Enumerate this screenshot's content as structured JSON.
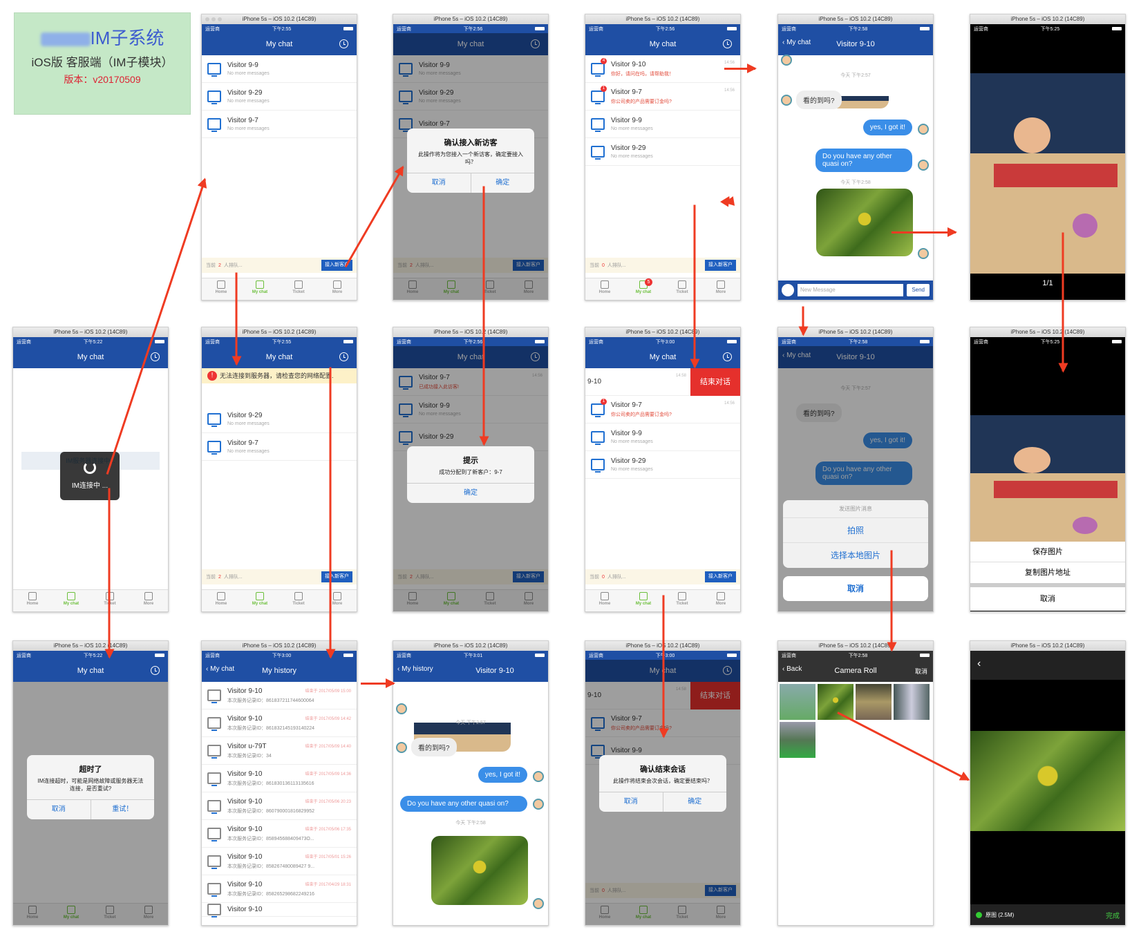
{
  "doc": {
    "title_blurred": "IM子系统",
    "subtitle": "iOS版 客服端（IM子模块）",
    "version": "版本：v20170509"
  },
  "common": {
    "sim_title": "iPhone 5s – iOS 10.2 (14C89)",
    "carrier": "运营商",
    "mychat": "My chat",
    "myhistory": "My history",
    "nomore": "No more messages",
    "queue_prefix": "当前",
    "queue_suffix": "人排队...",
    "accept_btn": "接入新客户",
    "tabs": [
      "Home",
      "My chat",
      "Ticket",
      "More"
    ],
    "today_257": "今天 下午2:57",
    "today_258": "今天 下午2:58",
    "q_see": "看的到吗?",
    "a_yes": "yes, I got it!",
    "q_other": "Do you have any other quasi on?",
    "visitor_910": "Visitor 9-10",
    "visitor_99": "Visitor 9-9",
    "visitor_929": "Visitor 9-29",
    "visitor_97": "Visitor 9-7",
    "cancel": "取消",
    "confirm": "确定",
    "time1456": "14:56",
    "time1458": "14:58",
    "count2": "2",
    "count0": "0",
    "send": "Send",
    "new_message": "New Message"
  },
  "times": {
    "t255": "下午2:55",
    "t256": "下午2:56",
    "t258": "下午2:58",
    "t300": "下午3:00",
    "t301": "下午3:01",
    "t522": "下午5:22",
    "t525": "下午5:25"
  },
  "screens": {
    "p2": {
      "dialog_title": "确认接入新访客",
      "dialog_msg": "此操作将为您接入一个新访客，确定要接入吗？"
    },
    "p3": {
      "msg910": "你好，请问在吗，请帮助我！",
      "msg97": "你公司卖的产品需要订金吗?",
      "badge": "5",
      "badge_dot4": "4",
      "badge_dot1": "1"
    },
    "p5": {
      "page": "1/1"
    },
    "m0": {
      "banner": "IM服务器连接中...",
      "loading": "IM连接中 ..."
    },
    "m1": {
      "error": "无法连接到服务器，请检查您的网络配置."
    },
    "m2": {
      "msg97": "已成功接入此访客!",
      "dialog_title": "提示",
      "dialog_msg": "成功分配到了新客户：9-7"
    },
    "m3": {
      "end": "结束对话",
      "row": "9-10"
    },
    "m4": {
      "sheet_title": "发送图片消息",
      "take": "拍照",
      "pick": "选择本地图片"
    },
    "m5": {
      "save": "保存图片",
      "copy": "复制图片地址"
    },
    "b0": {
      "dialog_title": "超时了",
      "dialog_msg": "IM连接超时，可能是网络故障或服务器无法连接，是否重试?",
      "retry": "重试！"
    },
    "b1": {
      "rows": [
        {
          "t": "结束于 2017/05/09 15:00",
          "id": "本次服务记录ID：861837211744600064",
          "n": "Visitor 9-10"
        },
        {
          "t": "结束于 2017/05/09 14:42",
          "id": "本次服务记录ID：861832145193140224",
          "n": "Visitor 9-10"
        },
        {
          "t": "结束于 2017/05/09 14:40",
          "id": "本次服务记录ID：34",
          "n": "Visitor u-79T"
        },
        {
          "t": "结束于 2017/05/09 14:36",
          "id": "本次服务记录ID：861830136113135616",
          "n": "Visitor 9-10"
        },
        {
          "t": "结束于 2017/05/06 20:23",
          "id": "本次服务记录ID：860790001816829952",
          "n": "Visitor 9-10"
        },
        {
          "t": "结束于 2017/05/06 17:35",
          "id": "本次服务记录ID：858945688409473O...",
          "n": "Visitor 9-10"
        },
        {
          "t": "结束于 2017/05/01 15:26",
          "id": "本次服务记录ID：858267480089427 9...",
          "n": "Visitor 9-10"
        },
        {
          "t": "结束于 2017/04/29 18:31",
          "id": "本次服务记录ID：858265298682249216",
          "n": "Visitor 9-10"
        }
      ],
      "last": "Visitor 9-10"
    },
    "b2": {
      "q_other": "Do you have any other quasi on?"
    },
    "b3": {
      "dialog_title": "确认结束会话",
      "dialog_msg": "此操作将结束会次会话，确定要结束吗？"
    },
    "b4": {
      "back": "Back",
      "title": "Camera Roll",
      "cancel": "取消"
    },
    "b5": {
      "orig": "原图 (2.5M)",
      "done": "完成"
    }
  }
}
